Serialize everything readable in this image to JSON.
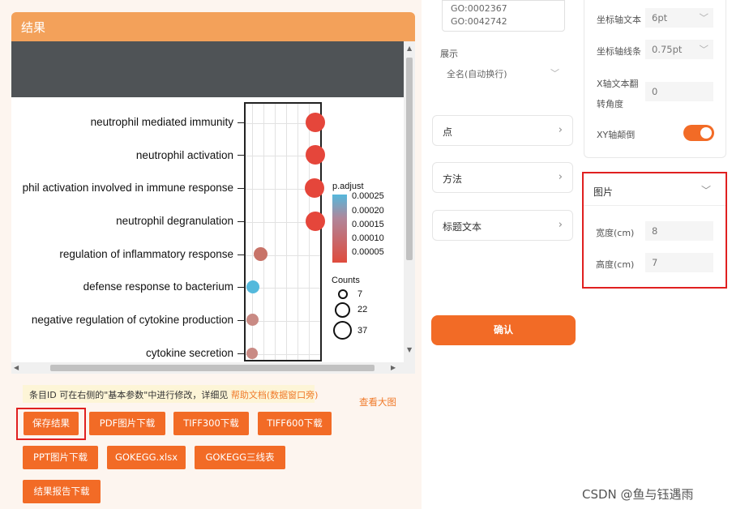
{
  "result": {
    "title": "结果"
  },
  "plot": {
    "terms": [
      "neutrophil mediated immunity",
      "neutrophil activation",
      "phil activation involved in immune response",
      "neutrophil degranulation",
      "regulation of inflammatory response",
      "defense response to bacterium",
      "negative regulation of cytokine production",
      "cytokine secretion"
    ],
    "legend_title": "p.adjust",
    "legend_values": [
      "0.00025",
      "0.00020",
      "0.00015",
      "0.00010",
      "0.00005"
    ],
    "counts_title": "Counts",
    "counts_values": [
      "7",
      "22",
      "37"
    ]
  },
  "note": {
    "text": "条目ID 可在右侧的\"基本参数\"中进行修改，详细见 ",
    "link": "帮助文档(数据窗口旁)"
  },
  "view_large": "查看大图",
  "buttons": {
    "save": "保存结果",
    "pdf": "PDF图片下载",
    "tiff300": "TIFF300下载",
    "tiff600": "TIFF600下载",
    "ppt": "PPT图片下载",
    "xlsx": "GOKEGG.xlsx",
    "threeline": "GOKEGG三线表",
    "report": "结果报告下载"
  },
  "middle": {
    "go_text": "GO:0002367\nGO:0042742",
    "display_label": "展示",
    "display_value": "全名(自动换行)",
    "accordions": [
      "点",
      "方法",
      "标题文本"
    ],
    "confirm": "确认"
  },
  "right": {
    "axis_text_label": "坐标轴文本",
    "axis_text_value": "6pt",
    "axis_line_label": "坐标轴线条",
    "axis_line_value": "0.75pt",
    "x_angle_label_1": "X轴文本翻",
    "x_angle_label_2": "转角度",
    "x_angle_value": "0",
    "xy_flip_label": "XY轴颠倒",
    "image_section": "图片",
    "width_label": "宽度(cm)",
    "width_value": "8",
    "height_label": "高度(cm)",
    "height_value": "7"
  },
  "watermark": "CSDN @鱼与钰遇雨",
  "colors": {
    "accent": "#f26b26",
    "header": "#f3a15a",
    "highlight": "#e02020"
  }
}
